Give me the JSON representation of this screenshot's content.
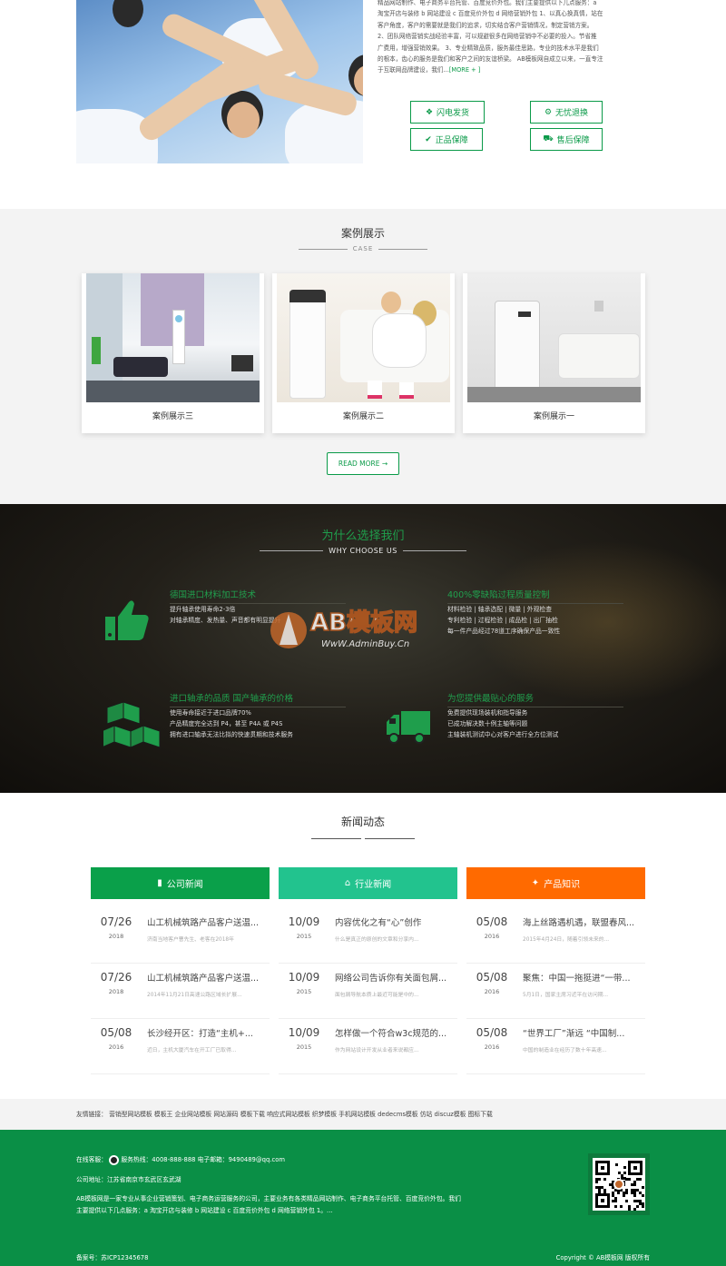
{
  "about": {
    "text_lines": [
      "精品网站制作、电子商务平台托管、百度竞价外包。我们主要提供以下几点服务：a",
      "淘宝开店与装修 b 网站建设 c 百度竞价外包 d 网络营销外包 1、以真心换真情，站在",
      "客户角度，客户的需要就是我们的追求，切实结合客户营销情况，制定营销方案。",
      "2、团队网络营销实战经验丰富，可以规避很多在网络营销中不必要的投入。节省推",
      "广费用，增强营销效果。 3、专业精致品质，服务最佳思路，专业的技术水平是我们",
      "的根本，齿心的服务是我们和客户之间的友谊桥梁。 AB模板网自成立以来，一直专注",
      "于互联网品牌建设，我们..."
    ],
    "more_label": "[MORE + ]",
    "features": [
      {
        "label": "闪电发货",
        "icon": "cubes-icon"
      },
      {
        "label": "无忧退换",
        "icon": "gears-icon"
      },
      {
        "label": "正品保障",
        "icon": "check-circle-icon"
      },
      {
        "label": "售后保障",
        "icon": "truck-icon"
      }
    ]
  },
  "cases": {
    "title": "案例展示",
    "subtitle": "CASE",
    "items": [
      {
        "caption": "案例展示三"
      },
      {
        "caption": "案例展示二"
      },
      {
        "caption": "案例展示一"
      }
    ],
    "read_more": "READ MORE →"
  },
  "why": {
    "title": "为什么选择我们",
    "subtitle": "WHY CHOOSE US",
    "items": [
      {
        "title": "德国进口材料加工技术",
        "lines": [
          "提升轴承使用寿命2-3倍",
          "对轴承精度、发热量、声音都有明显提升"
        ],
        "icon": "thumbs-up-icon"
      },
      {
        "title": "400%零缺陷过程质量控制",
        "lines": [
          "材料检验 | 轴承选配 | 微量 | 外观检查",
          "专利检验 | 过程检验 | 成品检 | 出厂抽检",
          "每一件产品经过78道工序确保产品一致性"
        ],
        "icon": "check-icon"
      },
      {
        "title": "进口轴承的品质 国产轴承的价格",
        "lines": [
          "使用寿命接近于进口品牌70%",
          "产品精度完全达到 P4，甚至 P4A 或 P4S",
          "拥有进口轴承无法比拟的快速贯期和技术服务"
        ],
        "icon": "cubes-icon"
      },
      {
        "title": "为您提供最贴心的服务",
        "lines": [
          "免费提供现场装机和指导服务",
          "已成功解决数十例主轴等问题",
          "主轴装机测试中心对客户进行全方位测试"
        ],
        "icon": "truck-icon"
      }
    ],
    "watermark": "AB模板网",
    "watermark_url": "WwW.AdminBuy.Cn"
  },
  "news": {
    "title": "新闻动态",
    "columns": [
      {
        "head": "公司新闻",
        "icon": "book-icon",
        "color": "#0aa04a",
        "rows": [
          {
            "date": "07/26",
            "year": "2018",
            "title": "山工机械筑路产品客户送温...",
            "desc": "济南当地客户曹先生、老客在2018年"
          },
          {
            "date": "07/26",
            "year": "2018",
            "title": "山工机械筑路产品客户送温...",
            "desc": "2014年11月21日高速公路区域长扩展..."
          },
          {
            "date": "05/08",
            "year": "2016",
            "title": "长沙经开区：打造“主机+...",
            "desc": "近日，主机大厦汽车在开工厂已取得..."
          }
        ]
      },
      {
        "head": "行业新闻",
        "icon": "bank-icon",
        "color": "#22c38e",
        "rows": [
          {
            "date": "10/09",
            "year": "2015",
            "title": "内容优化之有“心”创作",
            "desc": "什么是真正的原创的文章和分享内..."
          },
          {
            "date": "10/09",
            "year": "2015",
            "title": "网络公司告诉你有关面包屑...",
            "desc": "面包屑导航本质上最近可能是中的..."
          },
          {
            "date": "10/09",
            "year": "2015",
            "title": "怎样做一个符合w3c规范的...",
            "desc": "作为网站设计开发从业者来说都应..."
          }
        ]
      },
      {
        "head": "产品知识",
        "icon": "graduation-cap-icon",
        "color": "#ff6a00",
        "rows": [
          {
            "date": "05/08",
            "year": "2016",
            "title": "海上丝路遇机遇，联盟春风...",
            "desc": "2015年4月24日，随着引领未来的..."
          },
          {
            "date": "05/08",
            "year": "2016",
            "title": "聚焦：中国一拖挺进“一带...",
            "desc": "5月1日，国家主席习近平在访问期..."
          },
          {
            "date": "05/08",
            "year": "2016",
            "title": "“世界工厂”渐远 “中国制...",
            "desc": "中国的制造业在经历了数十年高速..."
          }
        ]
      }
    ]
  },
  "links": {
    "label": "友情链接：",
    "items": "营销型网站模板  模板王  企业网站模板  网站源码  模板下载  响应式网站模板  织梦模板  手机网站模板  dedecms模板  仿站  discuz模板  图标下载"
  },
  "footer": {
    "line1_label": "在线客服：",
    "line1": "服务热线：4008-888-888  电子邮箱：9490489@qq.com",
    "line2": "公司地址：江苏省南京市玄武区玄武湖",
    "line3": "AB模板网是一家专业从事企业营销策划、电子商务运营服务的公司，主要业务有各类精品网站制作、电子商务平台托管、百度竞价外包。我们",
    "line4": "主要提供以下几点服务：a 淘宝开店与装修 b 网站建设 c 百度竞价外包 d 网络营销外包 1。...",
    "icp": "备案号：苏ICP12345678",
    "copyright": "Copyright © AB模板网 版权所有"
  }
}
